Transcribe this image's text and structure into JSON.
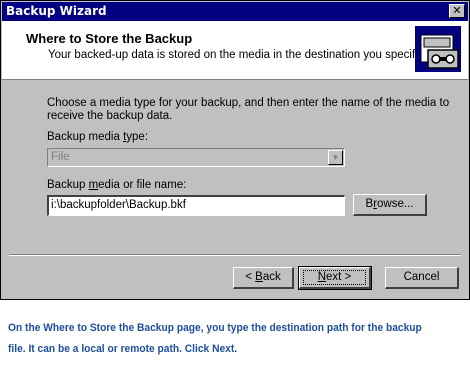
{
  "window": {
    "title": "Backup Wizard",
    "close_glyph": "✕"
  },
  "header": {
    "title": "Where to Store the Backup",
    "subtitle": "Your backed-up data is stored on the media in the destination you specify.",
    "icon": "backup-media-icon"
  },
  "body": {
    "instructions": "Choose a media type for your backup, and then enter the name of the media to receive the backup data.",
    "media_type_label": "Backup media type:",
    "media_type_value": "File",
    "media_name_label": "Backup media or file name:",
    "media_name_value": "i:\\backupfolder\\Backup.bkf",
    "browse_label": "Browse..."
  },
  "buttons": {
    "back_label": "< Back",
    "next_label": "Next >",
    "cancel_label": "Cancel"
  },
  "caption": "On the Where to Store the Backup page, you type the destination path for the backup file. It can be a local or remote path. Click Next.",
  "colors": {
    "titlebar": "#000080",
    "dialog": "#c0c0c0",
    "caption_text": "#1f4e9c"
  }
}
